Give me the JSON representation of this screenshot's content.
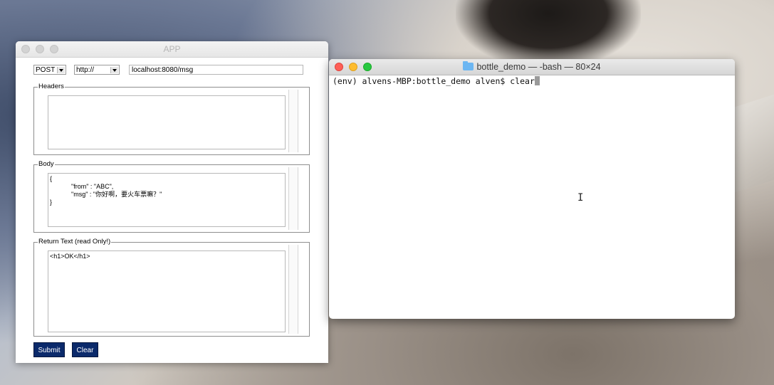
{
  "app": {
    "title": "APP",
    "method": "POST",
    "scheme": "http://",
    "url": "localhost:8080/msg",
    "headers_label": "Headers",
    "headers_text": "",
    "body_label": "Body",
    "body_text": "{\n            \"from\" : \"ABC\",\n            \"msg\" : \"你好啊，要火车票嘛？\"\n}",
    "return_label": "Return Text (read Only!)",
    "return_text": "<h1>OK</h1>",
    "submit_label": "Submit",
    "clear_label": "Clear"
  },
  "terminal": {
    "title": "bottle_demo — -bash — 80×24",
    "prompt": "(env) alvens-MBP:bottle_demo alven$ ",
    "command": "clear"
  },
  "colors": {
    "button_bg": "#0b2a6b",
    "close": "#fe5f57",
    "minimize": "#febc2e",
    "zoom": "#28c840",
    "folder": "#6cb6f2"
  },
  "icons": {
    "folder": "folder-icon",
    "dropdown": "chevron-down-icon",
    "cursor": "text-cursor-icon"
  }
}
